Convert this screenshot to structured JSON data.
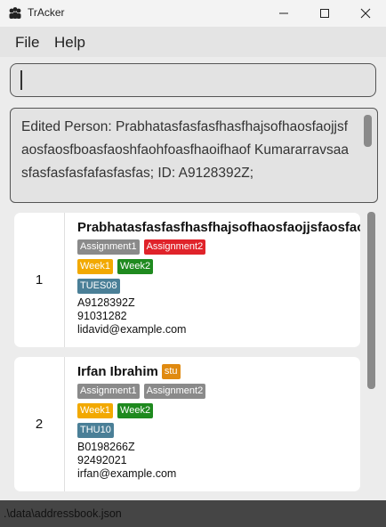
{
  "window": {
    "title": "TrAcker"
  },
  "menu": {
    "file": "File",
    "help": "Help"
  },
  "command": {
    "value": ""
  },
  "result": {
    "text": "Edited Person: Prabhatasfasfasfhasfhajsofhaosfaojjsfaosfaosfboasfaoshfaohfoasfhaoifhaof Kumararravsaasfasfasfasfafasfasfas; ID: A9128392Z;"
  },
  "persons": [
    {
      "index": "1",
      "name": "Prabhatasfasfasfhasfhajsofhaosfaojjsfaosfaosfboasfaoshfaohfoasfhaoifhaof Kumararravsaasfasfasfasfafasfasfas",
      "role": "",
      "assignments": [
        {
          "label": "Assignment1",
          "color": "#8a8a8a"
        },
        {
          "label": "Assignment2",
          "color": "#e0232a"
        }
      ],
      "weeks": [
        {
          "label": "Week1",
          "color": "#f2a900"
        },
        {
          "label": "Week2",
          "color": "#1f8a1f"
        }
      ],
      "tutorial": "TUES08",
      "id": "A9128392Z",
      "phone": "91031282",
      "email": "lidavid@example.com"
    },
    {
      "index": "2",
      "name": "Irfan Ibrahim",
      "role": "stu",
      "assignments": [
        {
          "label": "Assignment1",
          "color": "#8a8a8a"
        },
        {
          "label": "Assignment2",
          "color": "#8a8a8a"
        }
      ],
      "weeks": [
        {
          "label": "Week1",
          "color": "#f2a900"
        },
        {
          "label": "Week2",
          "color": "#1f8a1f"
        }
      ],
      "tutorial": "THU10",
      "id": "B0198266Z",
      "phone": "92492021",
      "email": "irfan@example.com"
    }
  ],
  "status": {
    "path": ".\\data\\addressbook.json"
  }
}
